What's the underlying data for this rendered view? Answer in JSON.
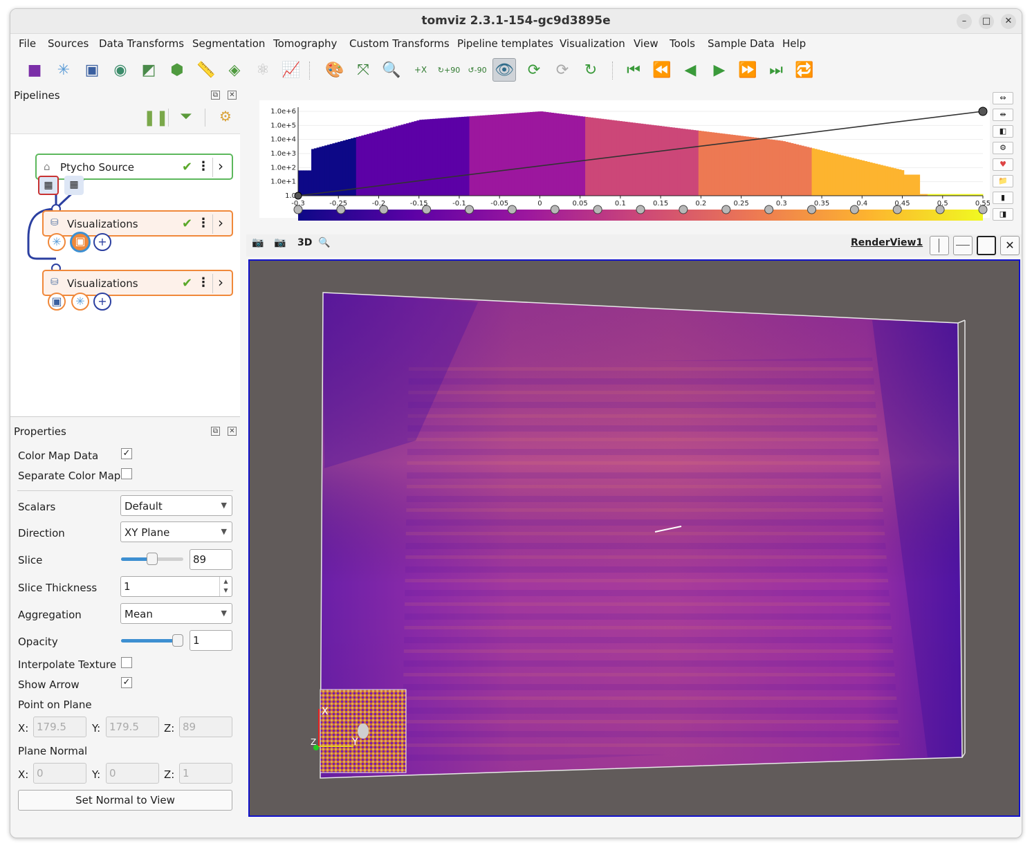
{
  "window": {
    "title": "tomviz 2.3.1-154-gc9d3895e"
  },
  "menu": [
    "File",
    "Sources",
    "Data Transforms",
    "Segmentation",
    "Tomography",
    "Custom Transforms",
    "Pipeline templates",
    "Visualization",
    "View",
    "Tools",
    "Sample Data",
    "Help"
  ],
  "toolbar": {
    "icons": [
      "cube-icon",
      "snowflake-icon",
      "box-outline-icon",
      "contour-icon",
      "slice-icon",
      "volume-icon",
      "ruler-icon",
      "threshold-icon",
      "molecule-icon",
      "chart-icon",
      "palette-icon",
      "reset-camera-icon",
      "zoom-to-box-icon",
      "axis-x-icon",
      "rotate-plus-90-icon",
      "rotate-minus-90-icon",
      "center-rotation-icon",
      "rotate-icon",
      "rotate-alt-icon",
      "rotate-3d-icon",
      "first-frame-icon",
      "previous-frame-icon",
      "reverse-play-icon",
      "play-icon",
      "next-frame-icon",
      "last-frame-icon",
      "loop-icon"
    ],
    "rot_plus": "+90",
    "rot_minus": "-90",
    "axis_x": "+X"
  },
  "pipelines": {
    "title": "Pipelines",
    "nodes": [
      {
        "label": "Ptycho Source",
        "color": "#5cb85c",
        "bg": "#ffffff"
      },
      {
        "label": "Visualizations",
        "color": "#f0883a",
        "bg": "#fdf1ea"
      },
      {
        "label": "Visualizations",
        "color": "#f0883a",
        "bg": "#fdf1ea"
      }
    ]
  },
  "properties": {
    "title": "Properties",
    "color_map_data": {
      "label": "Color Map Data",
      "checked": true
    },
    "separate_color_map": {
      "label": "Separate Color Map",
      "checked": false
    },
    "scalars": {
      "label": "Scalars",
      "value": "Default"
    },
    "direction": {
      "label": "Direction",
      "value": "XY Plane"
    },
    "slice": {
      "label": "Slice",
      "value": "89",
      "fraction": 0.5
    },
    "slice_thickness": {
      "label": "Slice Thickness",
      "value": "1"
    },
    "aggregation": {
      "label": "Aggregation",
      "value": "Mean"
    },
    "opacity": {
      "label": "Opacity",
      "value": "1",
      "fraction": 1.0
    },
    "interpolate_texture": {
      "label": "Interpolate Texture",
      "checked": false
    },
    "show_arrow": {
      "label": "Show Arrow",
      "checked": true
    },
    "point_on_plane": {
      "label": "Point on Plane",
      "x": "179.5",
      "y": "179.5",
      "z": "89"
    },
    "plane_normal": {
      "label": "Plane Normal",
      "x": "0",
      "y": "0",
      "z": "1"
    },
    "axis_x": "X:",
    "axis_y": "Y:",
    "axis_z": "Z:",
    "set_normal_button": "Set Normal to View"
  },
  "histogram": {
    "y_ticks": [
      "1.0e+6",
      "1.0e+5",
      "1.0e+4",
      "1.0e+3",
      "1.0e+2",
      "1.0e+1",
      "1.0"
    ],
    "x_ticks": [
      "-0.3",
      "-0.25",
      "-0.2",
      "-0.15",
      "-0.1",
      "-0.05",
      "0",
      "0.05",
      "0.1",
      "0.15",
      "0.2",
      "0.25",
      "0.3",
      "0.35",
      "0.4",
      "0.45",
      "0.5",
      "0.55"
    ],
    "x_range": [
      -0.3,
      0.55
    ],
    "colormap": [
      "#0d0887",
      "#5c01a6",
      "#9c179e",
      "#cc4778",
      "#ed7953",
      "#fdb42f",
      "#f0f921"
    ],
    "color_stops": 17
  },
  "view": {
    "name": "RenderView1",
    "mode_3d": "3D",
    "bg_color": "#615b5a",
    "orientation_labels": {
      "x": "X",
      "y": "Y",
      "z": "Z"
    }
  }
}
